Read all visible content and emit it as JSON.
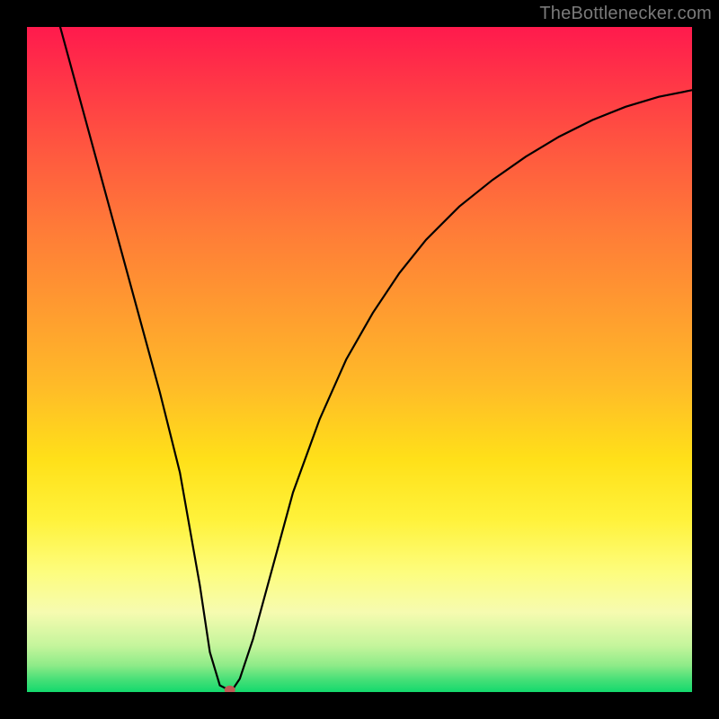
{
  "watermark": "TheBottlenecker.com",
  "colors": {
    "frame_bg": "#000000",
    "gradient_top": "#ff1a4d",
    "gradient_bottom": "#13d96d",
    "curve": "#000000",
    "marker": "#c05a55"
  },
  "chart_data": {
    "type": "line",
    "title": "",
    "xlabel": "",
    "ylabel": "",
    "xlim": [
      0,
      100
    ],
    "ylim": [
      0,
      100
    ],
    "series": [
      {
        "name": "bottleneck-curve",
        "x": [
          5,
          8,
          11,
          14,
          17,
          20,
          23,
          26,
          27.5,
          29,
          30,
          31,
          32,
          34,
          37,
          40,
          44,
          48,
          52,
          56,
          60,
          65,
          70,
          75,
          80,
          85,
          90,
          95,
          100
        ],
        "y": [
          100,
          89,
          78,
          67,
          56,
          45,
          33,
          16,
          6,
          1,
          0.5,
          0.5,
          2,
          8,
          19,
          30,
          41,
          50,
          57,
          63,
          68,
          73,
          77,
          80.5,
          83.5,
          86,
          88,
          89.5,
          90.5
        ]
      }
    ],
    "annotations": [
      {
        "name": "optimum-marker",
        "x": 30.5,
        "y": 0.3
      }
    ]
  }
}
